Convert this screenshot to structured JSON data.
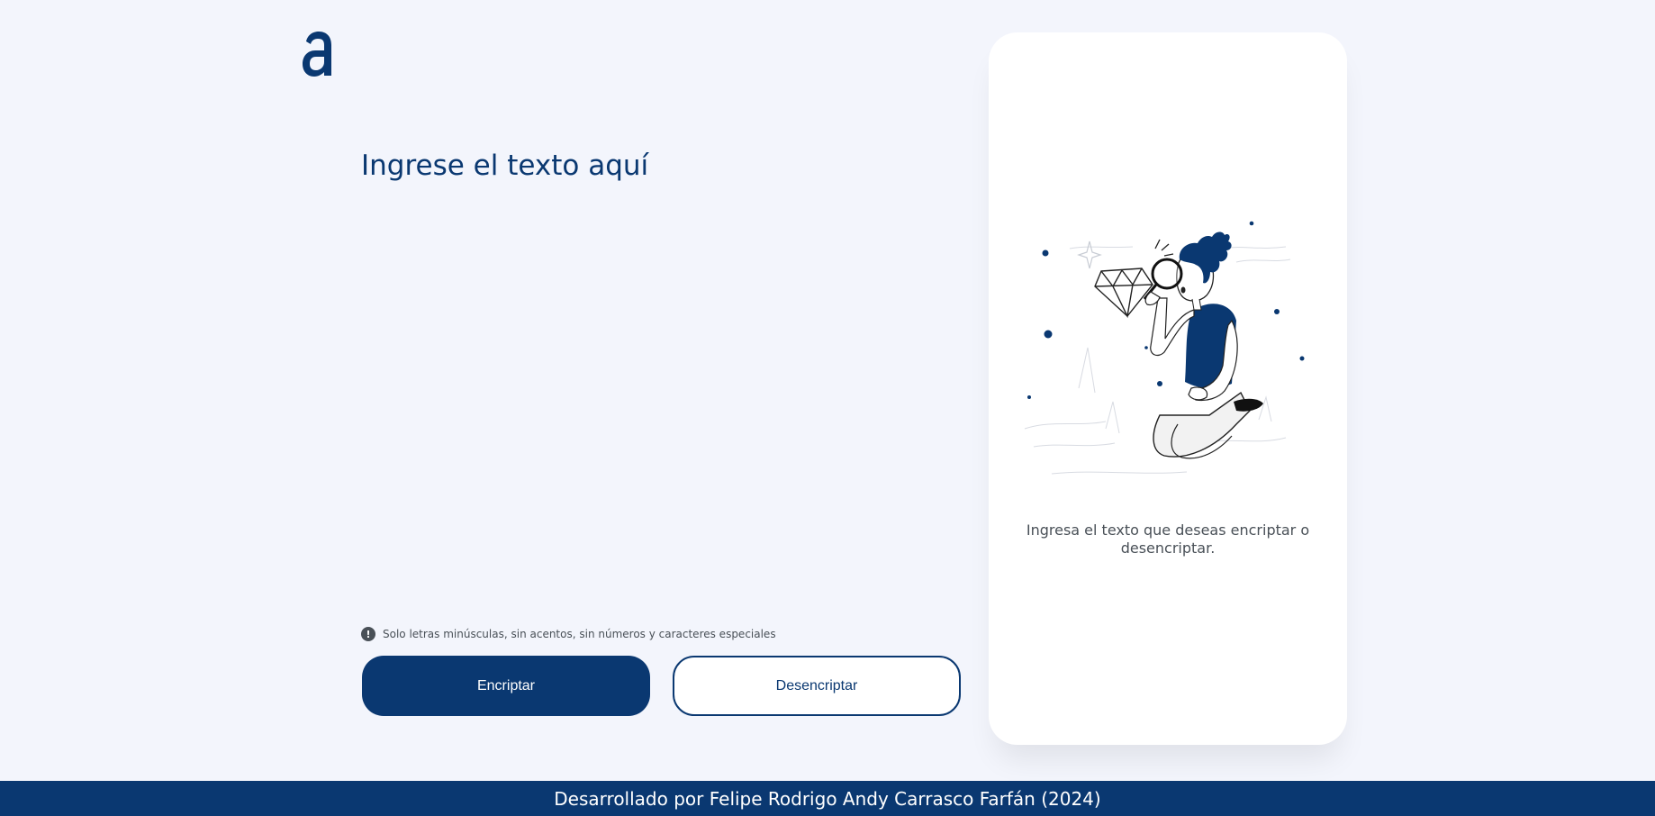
{
  "header": {
    "logo_icon": "alura-a-logo-icon"
  },
  "main": {
    "input": {
      "placeholder": "Ingrese el texto aquí",
      "value": ""
    },
    "hint": {
      "icon": "exclamation-circle-icon",
      "text": "Solo letras minúsculas, sin acentos, sin números y caracteres especiales"
    },
    "buttons": {
      "encrypt_label": "Encriptar",
      "decrypt_label": "Desencriptar"
    }
  },
  "output": {
    "illustration": "person-with-magnifying-glass-and-diamond",
    "message": "Ingresa el texto que deseas encriptar o desencriptar."
  },
  "footer": {
    "text": "Desarrollado por Felipe Rodrigo Andy Carrasco Farfán (2024)"
  },
  "colors": {
    "primary": "#0a3871",
    "background": "#f3f5fc",
    "text_muted": "#495057",
    "card": "#ffffff"
  }
}
